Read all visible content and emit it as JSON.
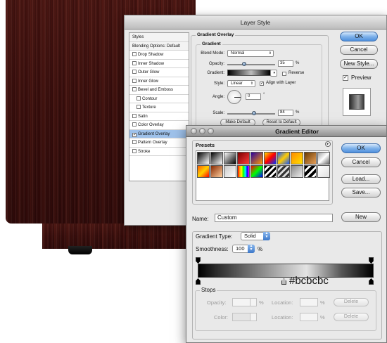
{
  "layer_style": {
    "title": "Layer Style",
    "styles_list": [
      {
        "label": "Styles",
        "checkbox": false,
        "header": true
      },
      {
        "label": "Blending Options: Default",
        "checkbox": false,
        "header": true
      },
      {
        "label": "Drop Shadow",
        "checkbox": true,
        "checked": false
      },
      {
        "label": "Inner Shadow",
        "checkbox": true,
        "checked": false
      },
      {
        "label": "Outer Glow",
        "checkbox": true,
        "checked": false
      },
      {
        "label": "Inner Glow",
        "checkbox": true,
        "checked": false
      },
      {
        "label": "Bevel and Emboss",
        "checkbox": true,
        "checked": false
      },
      {
        "label": "Contour",
        "checkbox": true,
        "checked": false,
        "indent": true
      },
      {
        "label": "Texture",
        "checkbox": true,
        "checked": false,
        "indent": true
      },
      {
        "label": "Satin",
        "checkbox": true,
        "checked": false
      },
      {
        "label": "Color Overlay",
        "checkbox": true,
        "checked": false
      },
      {
        "label": "Gradient Overlay",
        "checkbox": true,
        "checked": true,
        "selected": true
      },
      {
        "label": "Pattern Overlay",
        "checkbox": true,
        "checked": false
      },
      {
        "label": "Stroke",
        "checkbox": true,
        "checked": false
      }
    ],
    "gradient_overlay": {
      "section_title": "Gradient Overlay",
      "subsection_title": "Gradient",
      "blend_mode_label": "Blend Mode:",
      "blend_mode_value": "Normal",
      "opacity_label": "Opacity:",
      "opacity_value": "35",
      "opacity_fraction": 0.35,
      "percent": "%",
      "gradient_label": "Gradient:",
      "reverse_label": "Reverse",
      "style_label": "Style:",
      "style_value": "Linear",
      "align_label": "Align with Layer",
      "angle_label": "Angle:",
      "angle_value": "0",
      "degree": "°",
      "scale_label": "Scale:",
      "scale_value": "84",
      "scale_fraction": 0.56,
      "make_default": "Make Default",
      "reset_default": "Reset to Default"
    },
    "buttons": {
      "ok": "OK",
      "cancel": "Cancel",
      "new_style": "New Style...",
      "preview": "Preview"
    }
  },
  "gradient_editor": {
    "title": "Gradient Editor",
    "presets_label": "Presets",
    "buttons": {
      "ok": "OK",
      "cancel": "Cancel",
      "load": "Load...",
      "save": "Save...",
      "new": "New"
    },
    "name_label": "Name:",
    "name_value": "Custom",
    "gradient_type_label": "Gradient Type:",
    "gradient_type_value": "Solid",
    "smoothness_label": "Smoothness:",
    "smoothness_value": "100",
    "percent": "%",
    "selected_stop_color": "#bcbcbc",
    "stops": {
      "title": "Stops",
      "opacity_label": "Opacity:",
      "color_label": "Color:",
      "location_label": "Location:",
      "delete_label": "Delete"
    },
    "presets": [
      "linear-gradient(135deg,#000,#fff)",
      "linear-gradient(135deg,#000,transparent)",
      "linear-gradient(135deg,#fff,#000)",
      "linear-gradient(135deg,#7a0000,#ff3a3a)",
      "linear-gradient(135deg,#2a00a0,#ff9a00)",
      "linear-gradient(135deg,#ffe000,#ff0000,#0030ff)",
      "linear-gradient(135deg,#1a5aff,#ffcc00,#1a5aff)",
      "linear-gradient(135deg,#ff8a00,#ffe000)",
      "linear-gradient(135deg,#6a3a00,#e8a05a)",
      "linear-gradient(135deg,#a0a0a0,#fff,#6a6a6a)",
      "linear-gradient(135deg,#ff5a00,#ffd000,#ff0000)",
      "linear-gradient(135deg,#8a2a00,#ffd0a0)",
      "linear-gradient(135deg,#c8c8c8,#fff)",
      "linear-gradient(90deg,red,orange,yellow,lime,cyan,blue,magenta)",
      "linear-gradient(135deg,#ff0000,#00ff00,#0000ff)",
      "repeating-linear-gradient(135deg,#000 0 3px,#fff 3px 6px)",
      "repeating-linear-gradient(135deg,#333 0 3px,#ddd 3px 6px)",
      "linear-gradient(135deg,#888,#eee)",
      "repeating-linear-gradient(135deg,#000 0 4px,#fff 4px 7px)",
      "linear-gradient(135deg,#fff,#e0e0e0)"
    ]
  }
}
